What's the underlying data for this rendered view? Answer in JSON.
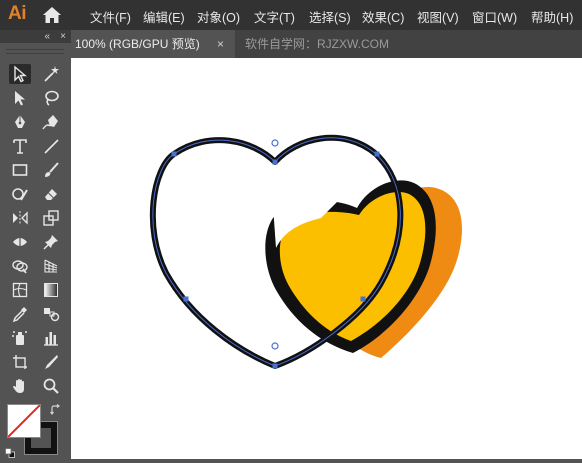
{
  "app": {
    "logo_text": "Ai",
    "home_icon": "home-icon",
    "accent_color": "#e0822c"
  },
  "menu": [
    {
      "label": "文件(F)"
    },
    {
      "label": "编辑(E)"
    },
    {
      "label": "对象(O)"
    },
    {
      "label": "文字(T)"
    },
    {
      "label": "选择(S)"
    },
    {
      "label": "效果(C)"
    },
    {
      "label": "视图(V)"
    },
    {
      "label": "窗口(W)"
    },
    {
      "label": "帮助(H)"
    }
  ],
  "toolbar": {
    "collapse_icon": "«",
    "close_icon": "×",
    "tools": [
      {
        "name": "selection-tool",
        "icon": "selection-arrow-icon",
        "active": true
      },
      {
        "name": "magic-wand-tool",
        "icon": "magic-wand-icon"
      },
      {
        "name": "direct-selection-tool",
        "icon": "direct-selection-icon"
      },
      {
        "name": "lasso-tool",
        "icon": "lasso-icon"
      },
      {
        "name": "pen-tool",
        "icon": "pen-icon"
      },
      {
        "name": "curvature-tool",
        "icon": "curvature-pen-icon"
      },
      {
        "name": "type-tool",
        "icon": "type-icon"
      },
      {
        "name": "line-tool",
        "icon": "line-segment-icon"
      },
      {
        "name": "rectangle-tool",
        "icon": "rectangle-icon"
      },
      {
        "name": "paintbrush-tool",
        "icon": "paintbrush-icon"
      },
      {
        "name": "shaper-tool",
        "icon": "shaper-icon"
      },
      {
        "name": "eraser-tool",
        "icon": "eraser-icon"
      },
      {
        "name": "reflect-tool",
        "icon": "reflect-icon"
      },
      {
        "name": "scale-tool",
        "icon": "scale-icon"
      },
      {
        "name": "width-tool",
        "icon": "width-icon"
      },
      {
        "name": "puppet-warp-tool",
        "icon": "pin-icon"
      },
      {
        "name": "shape-builder-tool",
        "icon": "shape-builder-icon"
      },
      {
        "name": "perspective-grid-tool",
        "icon": "perspective-grid-icon"
      },
      {
        "name": "mesh-tool",
        "icon": "mesh-icon"
      },
      {
        "name": "gradient-tool",
        "icon": "gradient-icon"
      },
      {
        "name": "eyedropper-tool",
        "icon": "eyedropper-icon"
      },
      {
        "name": "blend-tool",
        "icon": "blend-icon"
      },
      {
        "name": "symbol-sprayer-tool",
        "icon": "symbol-sprayer-icon"
      },
      {
        "name": "column-graph-tool",
        "icon": "column-graph-icon"
      },
      {
        "name": "artboard-tool",
        "icon": "artboard-icon"
      },
      {
        "name": "slice-tool",
        "icon": "slice-icon"
      },
      {
        "name": "hand-tool",
        "icon": "hand-icon"
      },
      {
        "name": "zoom-tool",
        "icon": "zoom-icon"
      }
    ],
    "fill_color": "#ffffff",
    "stroke_color": "#111111",
    "swap_icon": "swap-arrows-icon",
    "default_colors_icon": "default-colors-icon"
  },
  "document": {
    "tab_title": "100% (RGB/GPU 预览)",
    "tab_close": "×",
    "second_tab": "软件自学网：RJZXW.COM"
  },
  "artwork": {
    "heart_fill_color": "#fbbf00",
    "heart_shadow_color": "#ef8a12",
    "outline_color": "#111111",
    "selection_color": "#4a6fd0"
  }
}
